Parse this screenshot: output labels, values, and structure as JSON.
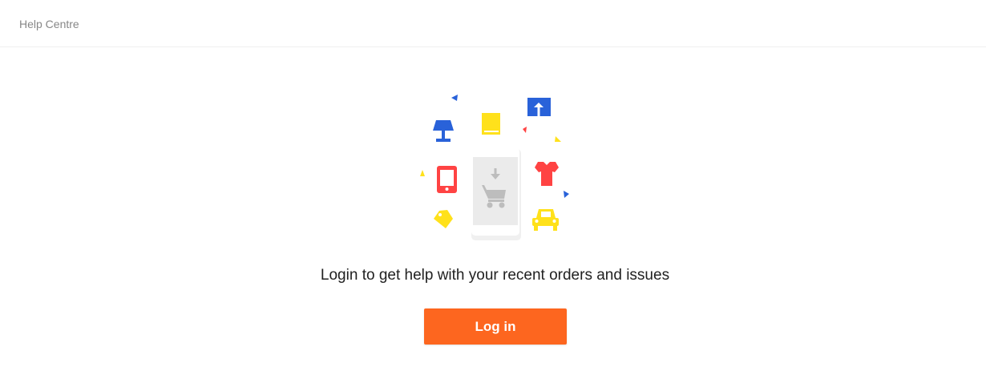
{
  "header": {
    "title": "Help Centre"
  },
  "main": {
    "message": "Login to get help with your recent orders and issues",
    "login_button": "Log in"
  },
  "colors": {
    "accent": "#fd661f",
    "blue": "#2962d9",
    "yellow": "#ffe11b",
    "red": "#ff4343",
    "grey": "#bdbdbd"
  },
  "illustration": {
    "icons": [
      "lamp-icon",
      "book-icon",
      "upload-box-icon",
      "smartphone-icon",
      "tshirt-icon",
      "price-tag-icon",
      "car-icon",
      "shopping-cart-icon"
    ]
  }
}
